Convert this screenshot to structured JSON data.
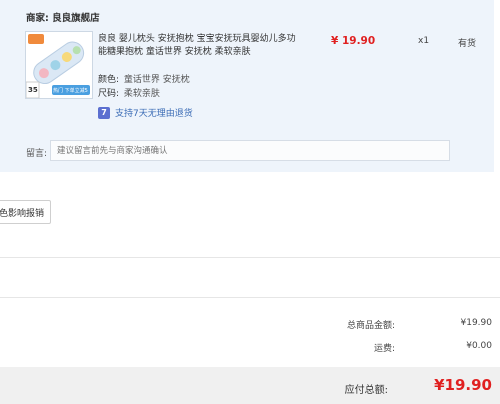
{
  "shop": {
    "label": "商家:",
    "name": "良良旗舰店"
  },
  "product": {
    "title": "良良 婴儿枕头 安抚抱枕 宝宝安抚玩具婴幼儿多功能糖果抱枕 童话世界 安抚枕 柔软亲肤",
    "price": "¥ 19.90",
    "quantity": "x1",
    "stock": "有货",
    "thumb_badge": "35",
    "thumb_banner": "热门 下单立减5",
    "attributes": [
      {
        "key": "颜色:",
        "value": "童话世界 安抚枕"
      },
      {
        "key": "尺码:",
        "value": "柔软亲肤"
      }
    ],
    "return_badge": "7",
    "return_policy": "支持7天无理由退货"
  },
  "note": {
    "label": "留言:",
    "placeholder": "建议留言前先与商家沟通确认"
  },
  "invoice": {
    "button_label": "色影响报销"
  },
  "summary": {
    "goods_amount_label": "总商品金额:",
    "goods_amount_value": "¥19.90",
    "shipping_label": "运费:",
    "shipping_value": "¥0.00"
  },
  "footer": {
    "payable_label": "应付总额:",
    "payable_total": "¥19.90"
  },
  "colors": {
    "accent_red": "#e02020",
    "link_blue": "#3a6bb5",
    "panel_bg": "#eef4fb"
  }
}
